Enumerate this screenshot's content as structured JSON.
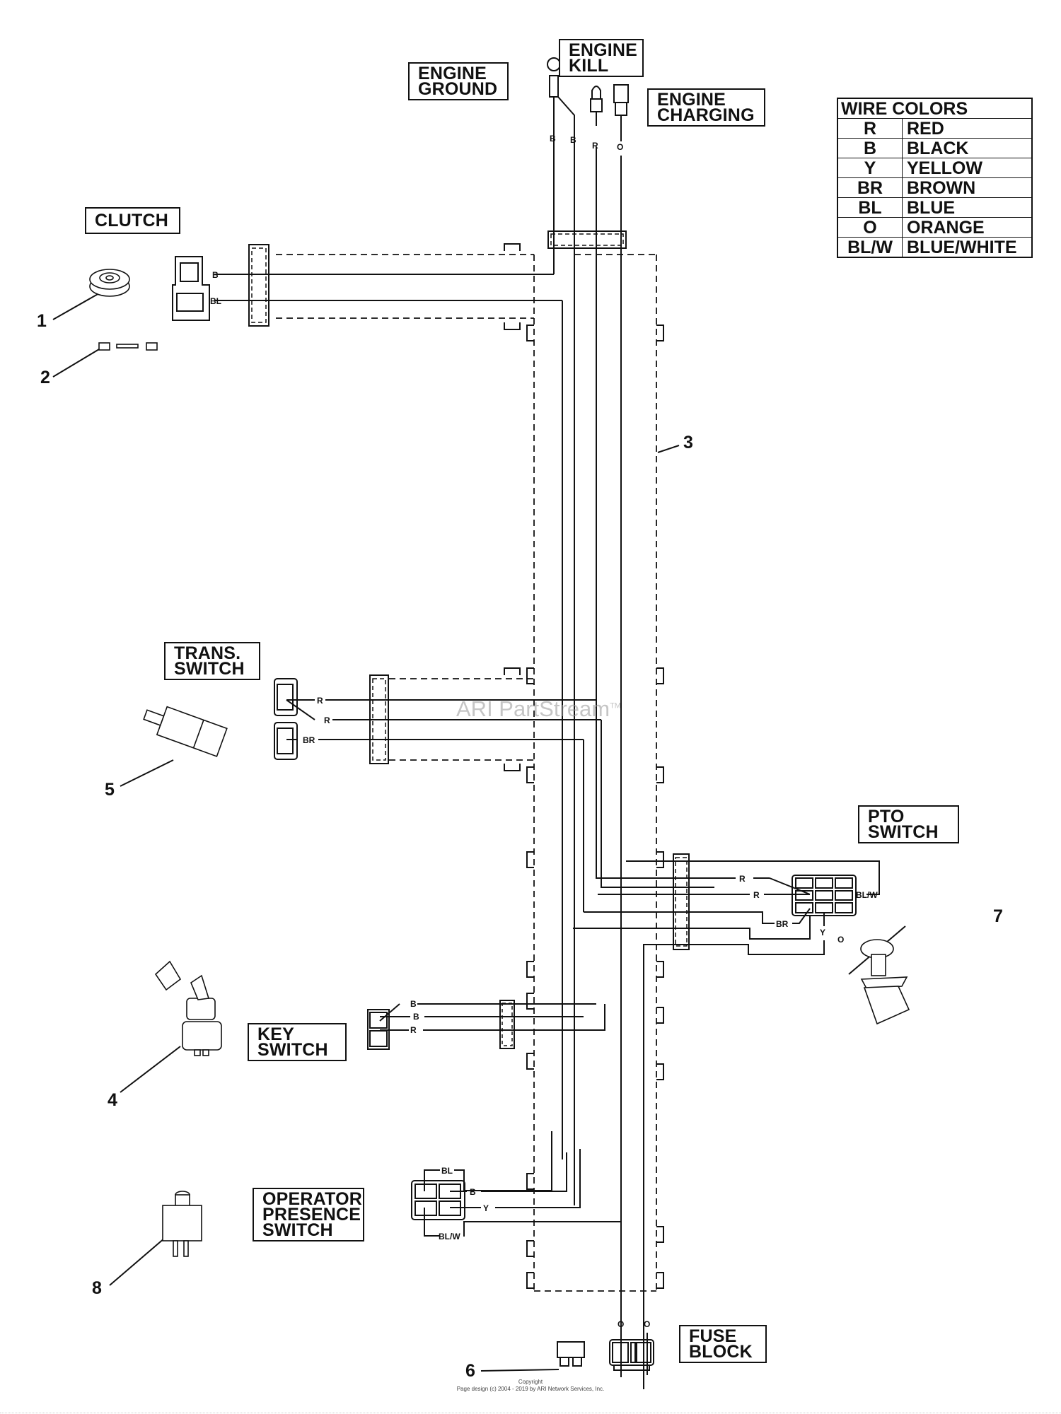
{
  "labels": {
    "engine_ground": [
      "ENGINE",
      "GROUND"
    ],
    "engine_kill": [
      "ENGINE",
      "KILL"
    ],
    "engine_charging": [
      "ENGINE",
      "CHARGING"
    ],
    "clutch": [
      "CLUTCH"
    ],
    "trans_switch": [
      "TRANS.",
      "SWITCH"
    ],
    "pto_switch": [
      "PTO",
      "SWITCH"
    ],
    "key_switch": [
      "KEY",
      "SWITCH"
    ],
    "operator_presence_switch": [
      "OPERATOR",
      "PRESENCE",
      "SWITCH"
    ],
    "fuse_block": [
      "FUSE",
      "BLOCK"
    ]
  },
  "wire_colors": {
    "title": "WIRE COLORS",
    "rows": [
      {
        "code": "R",
        "name": "RED"
      },
      {
        "code": "B",
        "name": "BLACK"
      },
      {
        "code": "Y",
        "name": "YELLOW"
      },
      {
        "code": "BR",
        "name": "BROWN"
      },
      {
        "code": "BL",
        "name": "BLUE"
      },
      {
        "code": "O",
        "name": "ORANGE"
      },
      {
        "code": "BL/W",
        "name": "BLUE/WHITE"
      }
    ]
  },
  "callouts": [
    "1",
    "2",
    "3",
    "4",
    "5",
    "6",
    "7",
    "8"
  ],
  "wire_labels": {
    "engine": [
      "B",
      "B",
      "R",
      "O"
    ],
    "clutch": [
      "B",
      "BL"
    ],
    "trans": [
      "R",
      "R",
      "BR"
    ],
    "pto": [
      "R",
      "R",
      "BL/W",
      "BR",
      "Y",
      "O"
    ],
    "key": [
      "B",
      "B",
      "R"
    ],
    "ops": [
      "BL",
      "B",
      "Y",
      "BL/W"
    ],
    "fuse": [
      "O",
      "O"
    ]
  },
  "watermark": {
    "text": "ARI PartStream",
    "tm": "TM"
  },
  "copyright": {
    "line1": "Copyright",
    "line2": "Page design (c) 2004 - 2019 by ARI Network Services, Inc."
  }
}
